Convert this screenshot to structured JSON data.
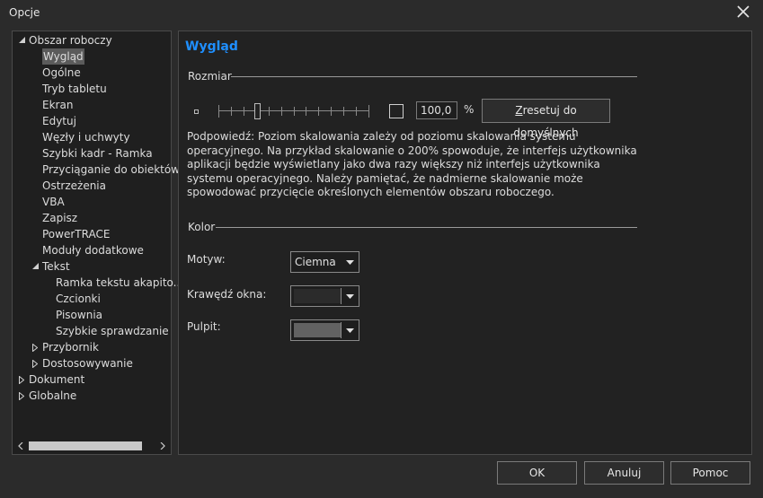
{
  "window": {
    "title": "Opcje",
    "close_icon": "close-icon"
  },
  "tree": {
    "items": [
      {
        "label": "Obszar roboczy",
        "level": 0,
        "expander": "expanded"
      },
      {
        "label": "Wygląd",
        "level": 1,
        "selected": true
      },
      {
        "label": "Ogólne",
        "level": 1
      },
      {
        "label": "Tryb tabletu",
        "level": 1
      },
      {
        "label": "Ekran",
        "level": 1
      },
      {
        "label": "Edytuj",
        "level": 1
      },
      {
        "label": "Węzły i uchwyty",
        "level": 1
      },
      {
        "label": "Szybki kadr - Ramka",
        "level": 1
      },
      {
        "label": "Przyciąganie do obiektów",
        "level": 1
      },
      {
        "label": "Ostrzeżenia",
        "level": 1
      },
      {
        "label": "VBA",
        "level": 1
      },
      {
        "label": "Zapisz",
        "level": 1
      },
      {
        "label": "PowerTRACE",
        "level": 1
      },
      {
        "label": "Moduły dodatkowe",
        "level": 1
      },
      {
        "label": "Tekst",
        "level": 1,
        "expander": "expanded"
      },
      {
        "label": "Ramka tekstu akapito...",
        "level": 2
      },
      {
        "label": "Czcionki",
        "level": 2
      },
      {
        "label": "Pisownia",
        "level": 2
      },
      {
        "label": "Szybkie sprawdzanie",
        "level": 2
      },
      {
        "label": "Przybornik",
        "level": 1,
        "expander": "collapsed"
      },
      {
        "label": "Dostosowywanie",
        "level": 1,
        "expander": "collapsed"
      },
      {
        "label": "Dokument",
        "level": 0,
        "expander": "collapsed"
      },
      {
        "label": "Globalne",
        "level": 0,
        "expander": "collapsed"
      }
    ]
  },
  "panel": {
    "heading": "Wygląd",
    "size_section": "Rozmiar",
    "scale_value": "100,0",
    "scale_unit": "%",
    "reset_button": "Zresetuj do domyślnych",
    "hint": "Podpowiedź: Poziom skalowania zależy od poziomu skalowania systemu operacyjnego. Na przykład skalowanie o 200% spowoduje, że interfejs użytkownika aplikacji będzie wyświetlany jako dwa razy większy niż interfejs użytkownika systemu operacyjnego. Należy pamiętać, że nadmierne skalowanie może spowodować przycięcie określonych elementów obszaru roboczego.",
    "color_section": "Kolor",
    "theme_label": "Motyw:",
    "theme_value": "Ciemna",
    "border_label": "Krawędź okna:",
    "border_color": "#2b2b2b",
    "desktop_label": "Pulpit:",
    "desktop_color": "#626262"
  },
  "buttons": {
    "ok": "OK",
    "cancel": "Anuluj",
    "help": "Pomoc"
  },
  "colors": {
    "accent": "#1f8fff",
    "background": "#2b2b2b",
    "panel": "#222222"
  }
}
